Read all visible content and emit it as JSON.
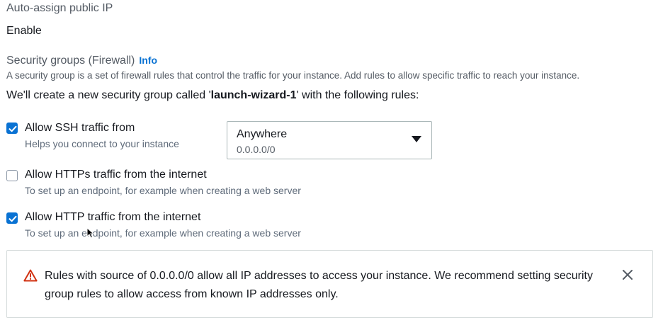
{
  "auto_assign": {
    "label": "Auto-assign public IP",
    "value": "Enable"
  },
  "security_groups": {
    "title": "Security groups (Firewall)",
    "info_link": "Info",
    "description": "A security group is a set of firewall rules that control the traffic for your instance. Add rules to allow specific traffic to reach your instance.",
    "create_prefix": "We'll create a new security group called '",
    "group_name": "launch-wizard-1",
    "create_suffix": "' with the following rules:"
  },
  "rules": [
    {
      "label": "Allow SSH traffic from",
      "description": "Helps you connect to your instance",
      "checked": true
    },
    {
      "label": "Allow HTTPs traffic from the internet",
      "description": "To set up an endpoint, for example when creating a web server",
      "checked": false
    },
    {
      "label": "Allow HTTP traffic from the internet",
      "description": "To set up an endpoint, for example when creating a web server",
      "checked": true
    }
  ],
  "ssh_source_select": {
    "selected": "Anywhere",
    "sub": "0.0.0.0/0"
  },
  "alert": {
    "message": "Rules with source of 0.0.0.0/0 allow all IP addresses to access your instance. We recommend setting security group rules to allow access from known IP addresses only."
  },
  "icons": {
    "checkbox_checked": "check-icon",
    "dropdown": "caret-down-icon",
    "warning": "warning-triangle-icon",
    "dismiss": "close-icon",
    "pointer": "mouse-cursor-icon"
  },
  "colors": {
    "accent": "#0972d3",
    "warning": "#d13212",
    "text": "#16191f",
    "muted": "#545b64"
  }
}
